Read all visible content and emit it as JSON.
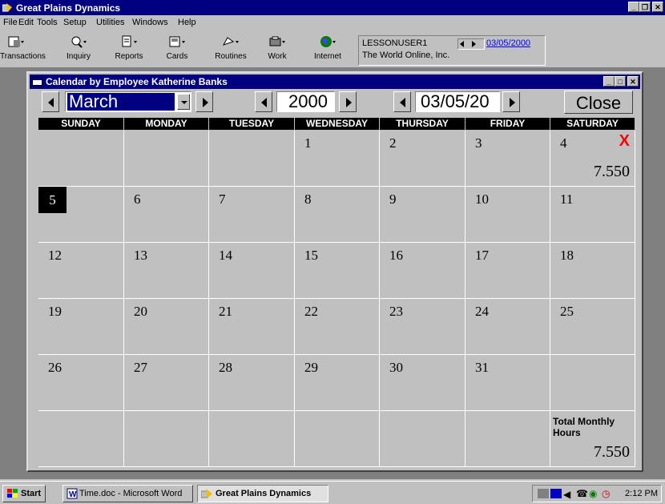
{
  "app": {
    "title": "Great Plains Dynamics"
  },
  "menu": [
    "File",
    "Edit",
    "Tools",
    "Setup",
    "Utilities",
    "Windows",
    "Help"
  ],
  "toolbar": {
    "items": [
      "Transactions",
      "Inquiry",
      "Reports",
      "Cards",
      "Routines",
      "Work",
      "Internet"
    ],
    "user": "LESSONUSER1",
    "company": "The World Online, Inc.",
    "date": "03/05/2000"
  },
  "calendar_window": {
    "title": "Calendar by Employee Katherine Banks",
    "month": "March",
    "year": "2000",
    "date": "03/05/20",
    "close_label": "Close",
    "weekdays": [
      "SUNDAY",
      "MONDAY",
      "TUESDAY",
      "WEDNESDAY",
      "THURSDAY",
      "FRIDAY",
      "SATURDAY"
    ],
    "weeks": [
      [
        "",
        "",
        "",
        "1",
        "2",
        "3",
        "4"
      ],
      [
        "5",
        "6",
        "7",
        "8",
        "9",
        "10",
        "11"
      ],
      [
        "12",
        "13",
        "14",
        "15",
        "16",
        "17",
        "18"
      ],
      [
        "19",
        "20",
        "21",
        "22",
        "23",
        "24",
        "25"
      ],
      [
        "26",
        "27",
        "28",
        "29",
        "30",
        "31",
        ""
      ]
    ],
    "selected_day": "5",
    "day_hours": {
      "4": "7.550"
    },
    "marked_day": "4",
    "mark_text": "X",
    "total_label": "Total Monthly Hours",
    "total_hours": "7.550",
    "mark_color": "#ff0000"
  },
  "taskbar": {
    "start": "Start",
    "tasks": [
      "Time.doc - Microsoft Word",
      "Great Plains Dynamics"
    ],
    "clock": "2:12 PM"
  },
  "colors": {
    "titlebar": "#000080",
    "face": "#c0c0c0",
    "workspace": "#808080"
  }
}
